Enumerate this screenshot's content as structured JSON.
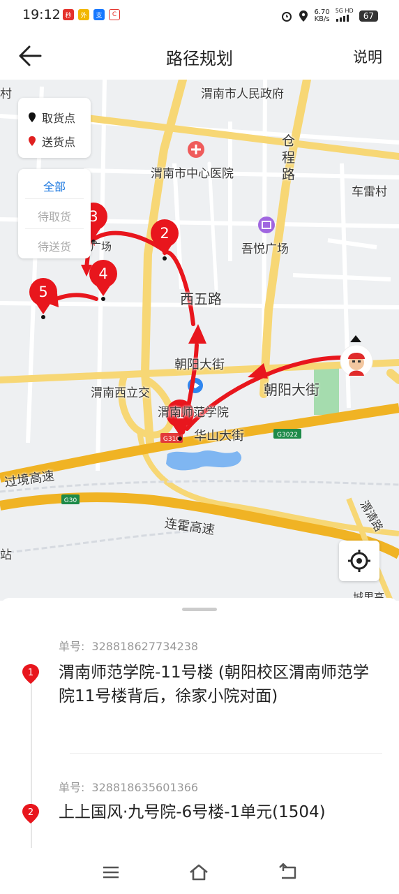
{
  "status_bar": {
    "time": "19:12",
    "net_speed_value": "6.70",
    "net_speed_unit": "KB/s",
    "signal_label": "5G HD",
    "battery": "67"
  },
  "header": {
    "back_icon": "arrow-left-icon",
    "title": "路径规划",
    "help": "说明"
  },
  "map": {
    "legend": {
      "pickup": "取货点",
      "delivery": "送货点",
      "pickup_color": "#111111",
      "delivery_color": "#e02020"
    },
    "filters": [
      {
        "label": "全部",
        "active": true
      },
      {
        "label": "待取货",
        "active": false
      },
      {
        "label": "待送货",
        "active": false
      }
    ],
    "route_color": "#e8161d",
    "stops": [
      "1",
      "2",
      "3",
      "4",
      "5"
    ],
    "labels": {
      "gov": "渭南市人民政府",
      "hospital": "渭南市中心医院",
      "cangcheng": "仓程路",
      "cheleicun": "车雷村",
      "wuyue": "吾悦广场",
      "square": "广场",
      "xiwu": "西五路",
      "chaoyang1": "朝阳大街",
      "chaoyang2": "朝阳大街",
      "xili": "渭南西立交",
      "school": "渭南师范学院",
      "huashan": "华山大街",
      "g3022": "G3022",
      "g310": "G310",
      "g30": "G30",
      "guojing": "过境高速",
      "lianhuo": "连霍高速",
      "weiqing": "渭清路",
      "chengli": "城里高",
      "left_cun": "村",
      "left_zhan": "站"
    }
  },
  "orders": [
    {
      "label": "单号:",
      "number": "328818627734238",
      "index": "1",
      "address": "渭南师范学院-11号楼 (朝阳校区渭南师范学院11号楼背后，徐家小院对面)"
    },
    {
      "label": "单号:",
      "number": "328818635601366",
      "index": "2",
      "address": "上上国风·九号院-6号楼-1单元(1504)"
    }
  ],
  "navbar": {
    "menu_icon": "menu-icon",
    "home_icon": "home-icon",
    "back_icon": "back-icon"
  }
}
